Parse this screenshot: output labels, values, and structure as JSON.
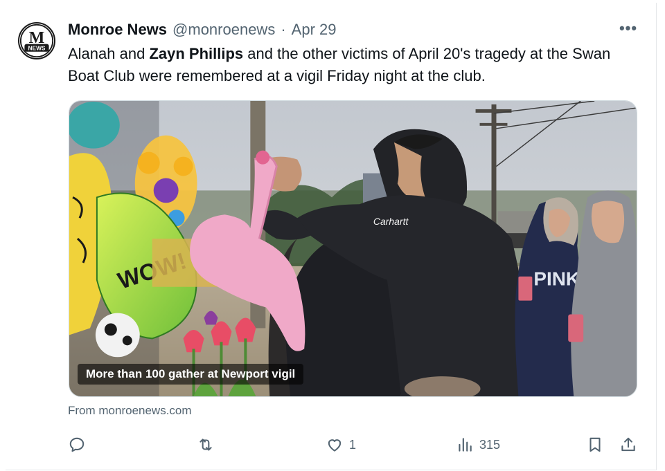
{
  "tweet": {
    "author_name": "Monroe News",
    "handle": "@monroenews",
    "separator": "·",
    "date": "Apr 29",
    "more_label": "•••",
    "text_part1": "Alanah and ",
    "text_bold": "Zayn Phillips",
    "text_part2": " and the other victims of April 20's tragedy at the Swan Boat Club were remembered at a vigil Friday night at the club.",
    "avatar_letter": "M",
    "avatar_badge": "NEWS"
  },
  "media": {
    "caption": "More than 100 gather at Newport vigil",
    "sign_text": "WOW!",
    "sweatshirt_text": "PINK"
  },
  "card_source": "From monroenews.com",
  "actions": {
    "reply_icon": "reply-icon",
    "retweet_icon": "retweet-icon",
    "like_icon": "heart-icon",
    "like_count": "1",
    "views_icon": "views-icon",
    "views_count": "315",
    "bookmark_icon": "bookmark-icon",
    "share_icon": "share-icon"
  },
  "colors": {
    "text_primary": "#0f1419",
    "text_secondary": "#536471",
    "border": "#cfd9de"
  }
}
